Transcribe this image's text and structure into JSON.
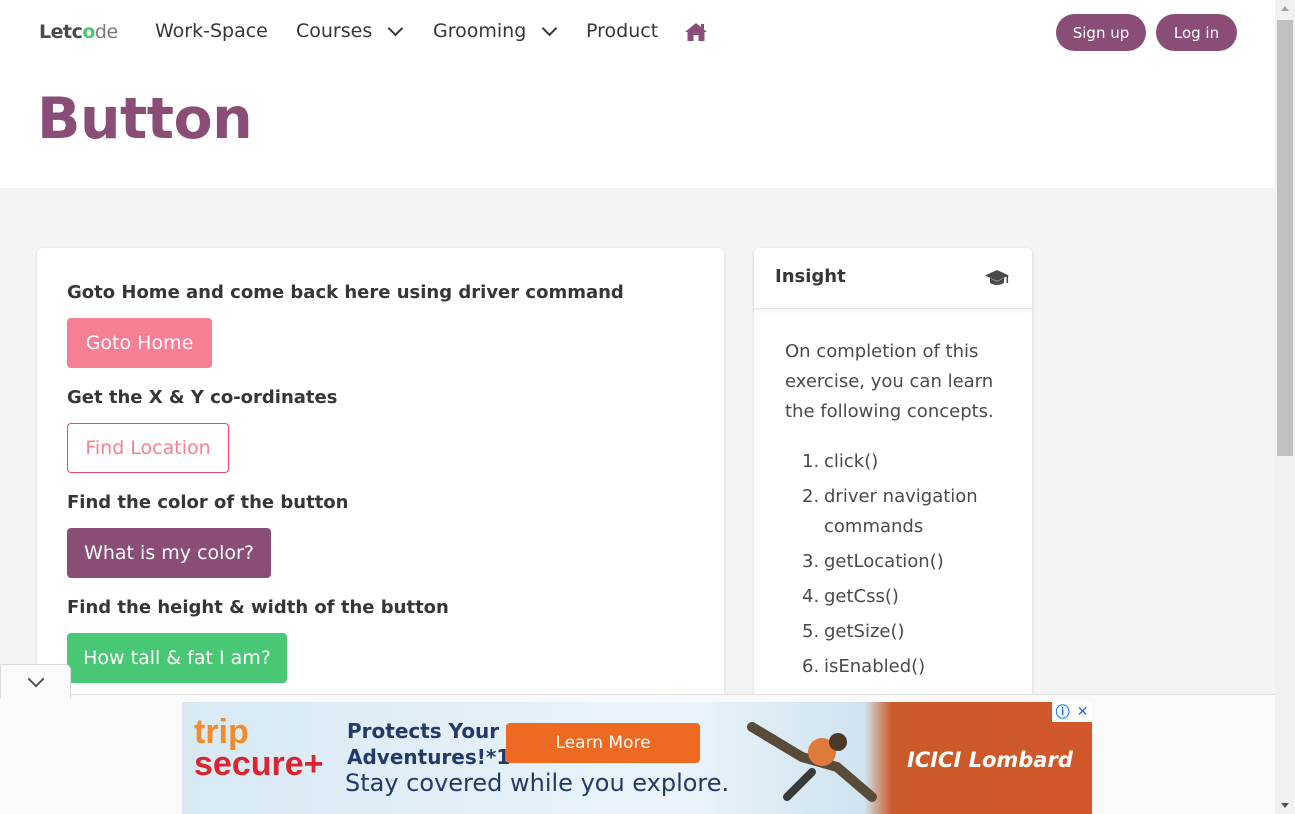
{
  "navbar": {
    "logo": {
      "pre": "Letc",
      "o": "o",
      "post": "de"
    },
    "items": [
      {
        "label": "Work-Space"
      },
      {
        "label": "Courses"
      },
      {
        "label": "Grooming"
      },
      {
        "label": "Product"
      }
    ],
    "signup_label": "Sign up",
    "login_label": "Log in",
    "accent": "#8a4d76"
  },
  "hero": {
    "title": "Button"
  },
  "main": {
    "sections": [
      {
        "question": "Goto Home and come back here using driver command",
        "button": "Goto Home",
        "color": "#f14668"
      },
      {
        "question": "Get the X & Y co-ordinates",
        "button": "Find Location",
        "color": "#f14668"
      },
      {
        "question": "Find the color of the button",
        "button": "What is my color?",
        "color": "#8a4d76"
      },
      {
        "question": "Find the height & width of the button",
        "button": "How tall & fat I am?",
        "color": "#48c774"
      }
    ]
  },
  "insight": {
    "title": "Insight",
    "intro": "On completion of this exercise, you can learn the following concepts.",
    "items": [
      "click()",
      "driver navigation commands",
      "getLocation()",
      "getCss()",
      "getSize()",
      "isEnabled()"
    ]
  },
  "ad": {
    "brand_trip": "trip",
    "brand_secure": "secure+",
    "headline_1": "Protects Your",
    "headline_2": "Adventures!*1",
    "button": "Learn More",
    "tagline": "Stay covered while you explore.",
    "partner": "ICICI Lombard"
  }
}
